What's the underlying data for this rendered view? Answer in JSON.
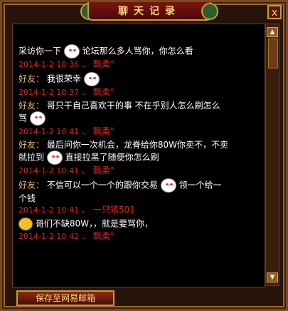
{
  "window": {
    "title": "聊天记录",
    "close_label": "x"
  },
  "scroll": {
    "up": "▲",
    "down": "▼"
  },
  "messages": [
    {
      "who": "",
      "text": "采访你一下",
      "emoji": "bunny",
      "text2": "论坛那么多人骂你，你怎么看",
      "ts": "2014-1-2 10:36",
      "name": "飘柔°"
    },
    {
      "who": "好友：",
      "text": "我很荣幸",
      "emoji": "bunny",
      "text2": "",
      "ts": "2014-1-2 10:37",
      "name": "飘柔°"
    },
    {
      "who": "好友：",
      "text": "哥只干自己喜欢干的事 不在乎别人怎么刷怎么",
      "text3": "骂",
      "emoji": "bunny",
      "ts": "2014-1-2 10:41",
      "name": "飘柔°"
    },
    {
      "who": "好友：",
      "text": "最后问你一次机会，龙脊给你80W你卖不，不卖",
      "text3": "就拉到",
      "emoji": "bunny",
      "text2": "直接拉黑了随便你怎么刷",
      "ts": "2014-1-2 10:41",
      "name": "飘柔°"
    },
    {
      "who": "好友：",
      "text": "不信可以一个一个的跟你交易",
      "emoji": "bunny",
      "text2": "领一个给一",
      "text3": "个钱",
      "ts": "2014-1-2 10:41",
      "name": "一只猪501"
    },
    {
      "who": "",
      "text": "哥们不缺80W，，就是要骂你，",
      "emoji": "smile",
      "ts": "2014-1-2 10:42",
      "name": "飘柔°"
    }
  ],
  "save_button": "保存至网易邮箱",
  "separator": "、"
}
